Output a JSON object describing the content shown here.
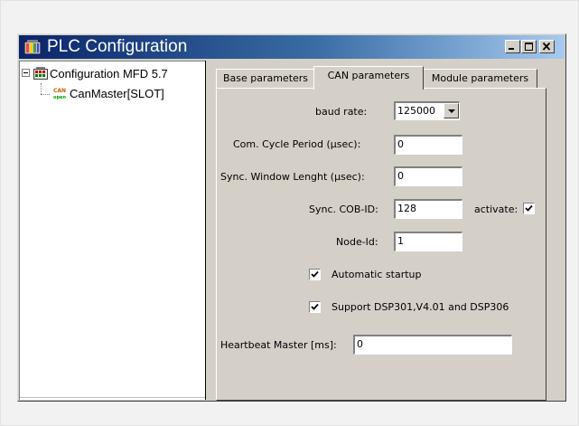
{
  "window": {
    "title": "PLC Configuration",
    "icon": "plc-config-icon",
    "controls": {
      "minimize": "minimize-icon",
      "maximize": "maximize-icon",
      "close": "close-icon"
    }
  },
  "tree": {
    "root": {
      "label": "Configuration MFD 5.7",
      "icon": "config-grid-icon",
      "expanded": true
    },
    "children": [
      {
        "label": "CanMaster[SLOT]",
        "icon": "can-open-icon"
      }
    ]
  },
  "tabs": [
    {
      "label": "Base parameters",
      "active": false
    },
    {
      "label": "CAN parameters",
      "active": true
    },
    {
      "label": "Module parameters",
      "active": false
    }
  ],
  "can_parameters": {
    "baud_rate": {
      "label": "baud rate:",
      "value": "125000"
    },
    "com_cycle": {
      "label": "Com. Cycle Period (µsec):",
      "value": "0"
    },
    "sync_window": {
      "label": "Sync. Window Lenght (µsec):",
      "value": "0"
    },
    "sync_cob": {
      "label": "Sync. COB-ID:",
      "value": "128"
    },
    "activate": {
      "label": "activate:",
      "checked": true
    },
    "node_id": {
      "label": "Node-Id:",
      "value": "1"
    },
    "auto_startup": {
      "label": "Automatic startup",
      "checked": true
    },
    "support_dsp": {
      "label": "Support DSP301,V4.01 and DSP306",
      "checked": true
    },
    "heartbeat": {
      "label": "Heartbeat Master [ms]:",
      "value": "0"
    }
  }
}
